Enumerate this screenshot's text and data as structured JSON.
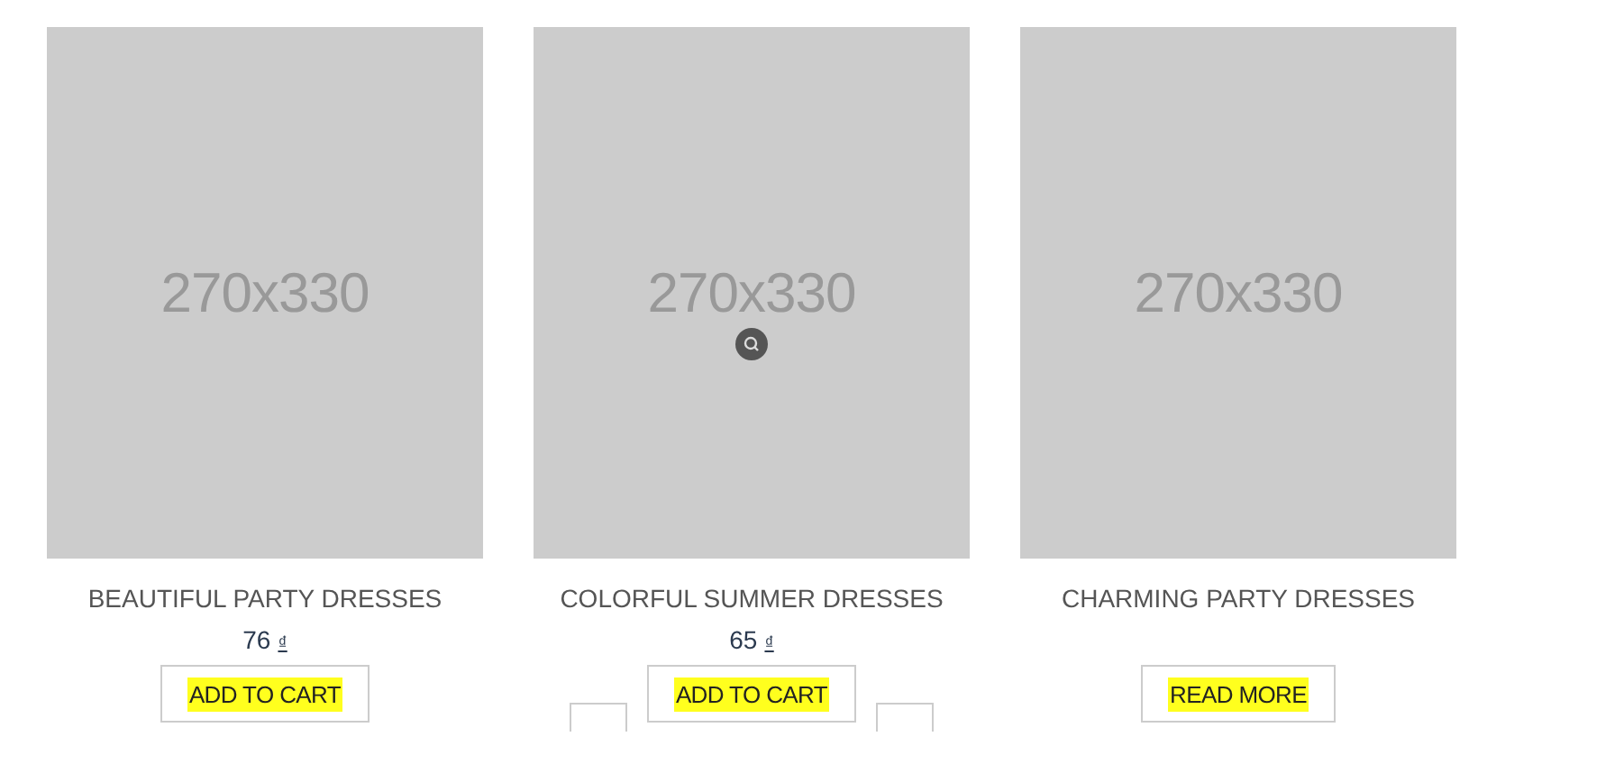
{
  "products": [
    {
      "image_label": "270x330",
      "zoom_icon": false,
      "title": "BEAUTIFUL PARTY DRESSES",
      "price": "76",
      "currency": "₫",
      "button": {
        "label": "ADD TO CART",
        "highlighted": true
      },
      "side_buttons": false
    },
    {
      "image_label": "270x330",
      "zoom_icon": true,
      "title": "COLORFUL SUMMER DRESSES",
      "price": "65",
      "currency": "₫",
      "button": {
        "label": "ADD TO CART",
        "highlighted": true
      },
      "side_buttons": true
    },
    {
      "image_label": "270x330",
      "zoom_icon": false,
      "title": "CHARMING PARTY DRESSES",
      "button": {
        "label": "READ MORE",
        "highlighted": true
      },
      "side_buttons": false
    }
  ]
}
